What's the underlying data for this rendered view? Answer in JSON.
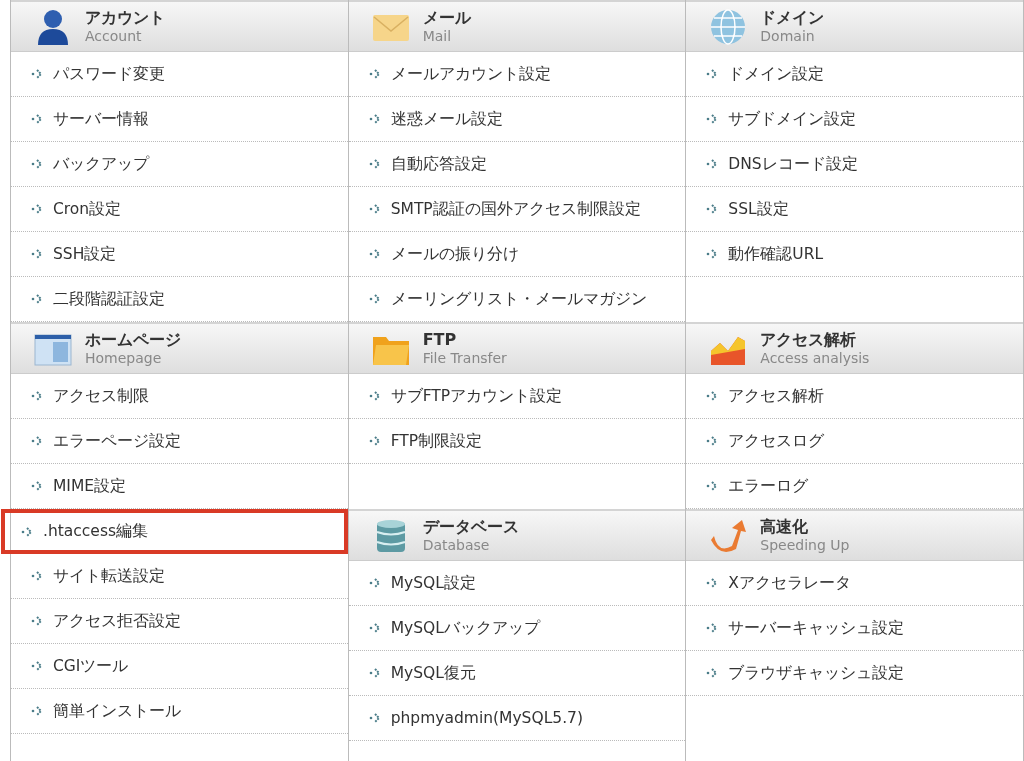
{
  "columns": [
    {
      "sections": [
        {
          "kind": "person",
          "title": "アカウント",
          "subtitle": "Account",
          "items": [
            {
              "label": "パスワード変更",
              "selected": false
            },
            {
              "label": "サーバー情報",
              "selected": false
            },
            {
              "label": "バックアップ",
              "selected": false
            },
            {
              "label": "Cron設定",
              "selected": false
            },
            {
              "label": "SSH設定",
              "selected": false
            },
            {
              "label": "二段階認証設定",
              "selected": false
            }
          ]
        },
        {
          "kind": "window",
          "title": "ホームページ",
          "subtitle": "Homepage",
          "items": [
            {
              "label": "アクセス制限",
              "selected": false
            },
            {
              "label": "エラーページ設定",
              "selected": false
            },
            {
              "label": "MIME設定",
              "selected": false
            },
            {
              "label": ".htaccess編集",
              "selected": true
            },
            {
              "label": "サイト転送設定",
              "selected": false
            },
            {
              "label": "アクセス拒否設定",
              "selected": false
            },
            {
              "label": "CGIツール",
              "selected": false
            },
            {
              "label": "簡単インストール",
              "selected": false
            }
          ]
        }
      ]
    },
    {
      "sections": [
        {
          "kind": "envelope",
          "title": "メール",
          "subtitle": "Mail",
          "items": [
            {
              "label": "メールアカウント設定",
              "selected": false
            },
            {
              "label": "迷惑メール設定",
              "selected": false
            },
            {
              "label": "自動応答設定",
              "selected": false
            },
            {
              "label": "SMTP認証の国外アクセス制限設定",
              "selected": false
            },
            {
              "label": "メールの振り分け",
              "selected": false
            },
            {
              "label": "メーリングリスト・メールマガジン",
              "selected": false
            }
          ]
        },
        {
          "kind": "folder",
          "title": "FTP",
          "subtitle": "File Transfer",
          "items": [
            {
              "label": "サブFTPアカウント設定",
              "selected": false
            },
            {
              "label": "FTP制限設定",
              "selected": false
            }
          ]
        },
        {
          "kind": "database",
          "title": "データベース",
          "subtitle": "Database",
          "items": [
            {
              "label": "MySQL設定",
              "selected": false
            },
            {
              "label": "MySQLバックアップ",
              "selected": false
            },
            {
              "label": "MySQL復元",
              "selected": false
            },
            {
              "label": "phpmyadmin(MySQL5.7)",
              "selected": false
            }
          ]
        }
      ]
    },
    {
      "sections": [
        {
          "kind": "globe",
          "title": "ドメイン",
          "subtitle": "Domain",
          "items": [
            {
              "label": "ドメイン設定",
              "selected": false
            },
            {
              "label": "サブドメイン設定",
              "selected": false
            },
            {
              "label": "DNSレコード設定",
              "selected": false
            },
            {
              "label": "SSL設定",
              "selected": false
            },
            {
              "label": "動作確認URL",
              "selected": false
            }
          ]
        },
        {
          "kind": "chart",
          "title": "アクセス解析",
          "subtitle": "Access analysis",
          "items": [
            {
              "label": "アクセス解析",
              "selected": false
            },
            {
              "label": "アクセスログ",
              "selected": false
            },
            {
              "label": "エラーログ",
              "selected": false
            }
          ]
        },
        {
          "kind": "arrow",
          "title": "高速化",
          "subtitle": "Speeding Up",
          "items": [
            {
              "label": "Xアクセラレータ",
              "selected": false
            },
            {
              "label": "サーバーキャッシュ設定",
              "selected": false
            },
            {
              "label": "ブラウザキャッシュ設定",
              "selected": false
            }
          ]
        }
      ]
    }
  ]
}
